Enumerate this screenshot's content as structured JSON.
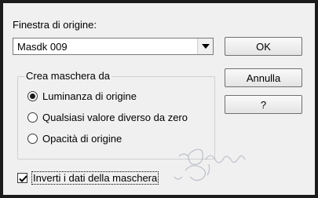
{
  "source": {
    "label": "Finestra di origine:",
    "selected": "Masdk 009"
  },
  "buttons": {
    "ok": "OK",
    "cancel": "Annulla",
    "help": "?"
  },
  "group": {
    "title": "Crea maschera da",
    "options": [
      {
        "label": "Luminanza di origine",
        "checked": true
      },
      {
        "label": "Qualsiasi valore diverso da zero",
        "checked": false
      },
      {
        "label": "Opacità di origine",
        "checked": false
      }
    ]
  },
  "invert": {
    "label": "Inverti i dati della maschera",
    "checked": true
  },
  "icons": {
    "dropdown": "chevron-down-icon",
    "watermark": "signature-watermark"
  }
}
